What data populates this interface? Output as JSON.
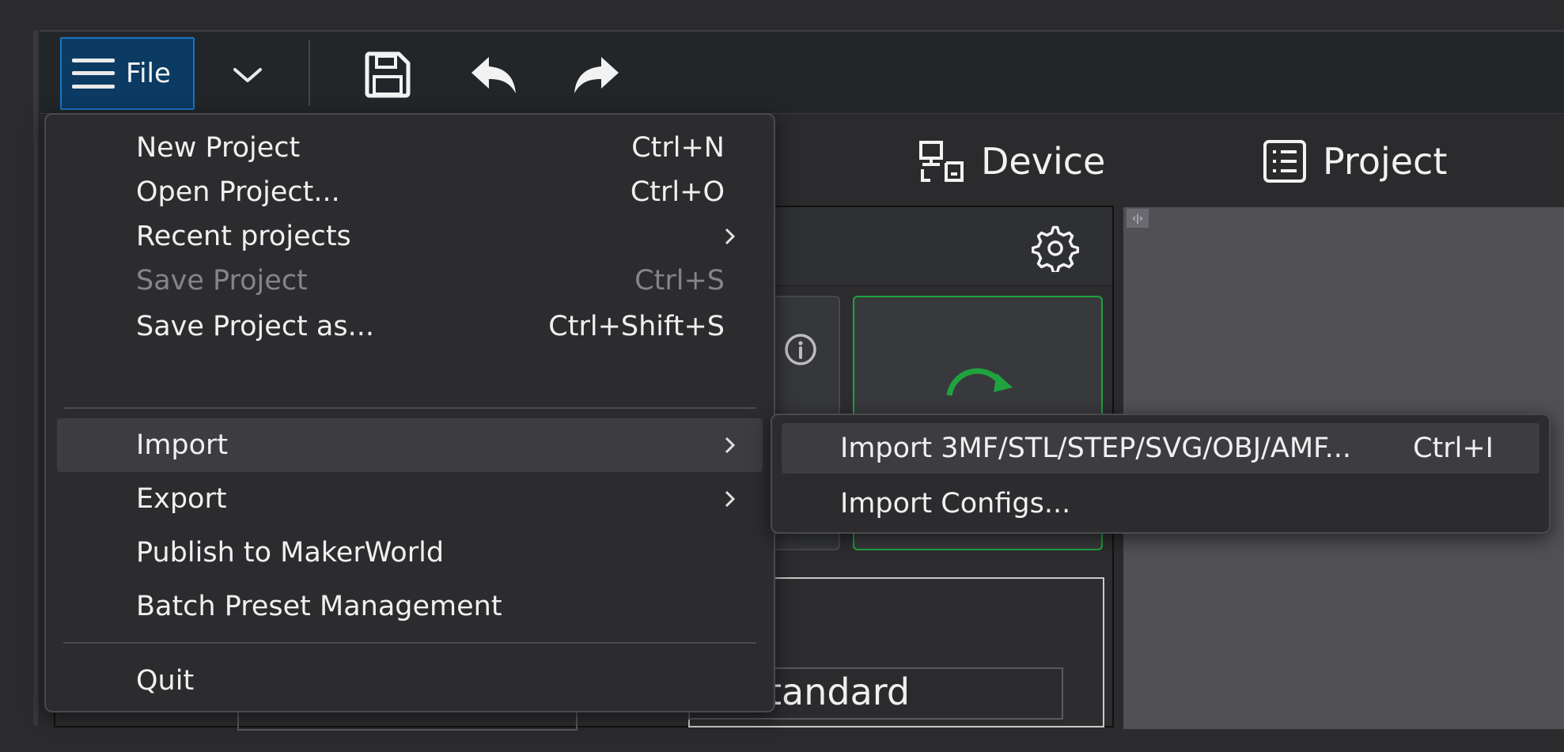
{
  "toolbar": {
    "file_label": "File",
    "icons": [
      "hamburger-menu-icon",
      "chevron-down-icon",
      "save-icon",
      "undo-icon",
      "redo-icon"
    ]
  },
  "tabs": [
    {
      "label": "Device",
      "icon": "device-icon"
    },
    {
      "label": "Project",
      "icon": "project-list-icon"
    }
  ],
  "panel": {
    "field_text": "tandard",
    "icons": [
      "gear-icon",
      "info-icon",
      "sync-icon"
    ]
  },
  "viewport": {
    "tag": "‹|›"
  },
  "file_menu": {
    "items": [
      {
        "label": "New Project",
        "shortcut": "Ctrl+N"
      },
      {
        "label": "Open Project...",
        "shortcut": "Ctrl+O"
      },
      {
        "label": "Recent projects",
        "shortcut": ""
      },
      {
        "label": "Save Project",
        "shortcut": "Ctrl+S"
      },
      {
        "label": "Save Project as...",
        "shortcut": "Ctrl+Shift+S"
      },
      {
        "label": "Import",
        "shortcut": ""
      },
      {
        "label": "Export",
        "shortcut": ""
      },
      {
        "label": "Publish to MakerWorld",
        "shortcut": ""
      },
      {
        "label": "Batch Preset Management",
        "shortcut": ""
      },
      {
        "label": "Quit",
        "shortcut": ""
      }
    ]
  },
  "import_submenu": {
    "items": [
      {
        "label": "Import 3MF/STL/STEP/SVG/OBJ/AMF...",
        "shortcut": "Ctrl+I"
      },
      {
        "label": "Import Configs...",
        "shortcut": ""
      }
    ]
  },
  "colors": {
    "accent": "#1a73c4",
    "accent_bg": "#0b3a62",
    "success": "#1fa33f",
    "menu_bg": "#2c2c2f"
  }
}
